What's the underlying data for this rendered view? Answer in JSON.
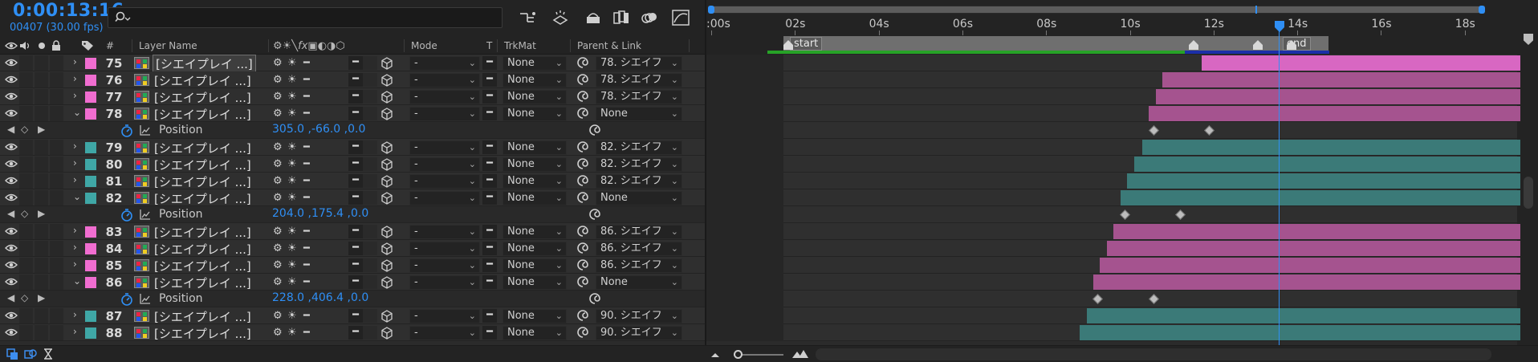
{
  "header": {
    "timecode": "0:00:13:16",
    "frames": "00407 (30.00 fps)",
    "search_placeholder": ""
  },
  "columns": {
    "label": "#",
    "layer_name": "Layer Name",
    "mode": "Mode",
    "t": "T",
    "trkmat": "TrkMat",
    "parent": "Parent & Link"
  },
  "layers": [
    {
      "num": "75",
      "name": "[シエイプレイ ...]",
      "color": "#f06dd0",
      "twirl": "›",
      "mode": "-",
      "trkmat": "None",
      "parent": "78. シエイフ",
      "selected": true
    },
    {
      "num": "76",
      "name": "[シエイプレイ ...]",
      "color": "#f06dd0",
      "twirl": "›",
      "mode": "-",
      "trkmat": "None",
      "parent": "78. シエイフ"
    },
    {
      "num": "77",
      "name": "[シエイプレイ ...]",
      "color": "#f06dd0",
      "twirl": "›",
      "mode": "-",
      "trkmat": "None",
      "parent": "78. シエイフ"
    },
    {
      "num": "78",
      "name": "[シエイプレイ ...]",
      "color": "#f06dd0",
      "twirl": "⌄",
      "mode": "-",
      "trkmat": "None",
      "parent": "None"
    },
    {
      "prop": "Position",
      "value": "305.0 ,-66.0 ,0.0"
    },
    {
      "num": "79",
      "name": "[シエイプレイ ...]",
      "color": "#3fa7a6",
      "twirl": "›",
      "mode": "-",
      "trkmat": "None",
      "parent": "82. シエイフ"
    },
    {
      "num": "80",
      "name": "[シエイプレイ ...]",
      "color": "#3fa7a6",
      "twirl": "›",
      "mode": "-",
      "trkmat": "None",
      "parent": "82. シエイフ"
    },
    {
      "num": "81",
      "name": "[シエイプレイ ...]",
      "color": "#3fa7a6",
      "twirl": "›",
      "mode": "-",
      "trkmat": "None",
      "parent": "82. シエイフ"
    },
    {
      "num": "82",
      "name": "[シエイプレイ ...]",
      "color": "#3fa7a6",
      "twirl": "⌄",
      "mode": "-",
      "trkmat": "None",
      "parent": "None"
    },
    {
      "prop": "Position",
      "value": "204.0 ,175.4 ,0.0"
    },
    {
      "num": "83",
      "name": "[シエイプレイ ...]",
      "color": "#f06dd0",
      "twirl": "›",
      "mode": "-",
      "trkmat": "None",
      "parent": "86. シエイフ"
    },
    {
      "num": "84",
      "name": "[シエイプレイ ...]",
      "color": "#f06dd0",
      "twirl": "›",
      "mode": "-",
      "trkmat": "None",
      "parent": "86. シエイフ"
    },
    {
      "num": "85",
      "name": "[シエイプレイ ...]",
      "color": "#f06dd0",
      "twirl": "›",
      "mode": "-",
      "trkmat": "None",
      "parent": "86. シエイフ"
    },
    {
      "num": "86",
      "name": "[シエイプレイ ...]",
      "color": "#f06dd0",
      "twirl": "⌄",
      "mode": "-",
      "trkmat": "None",
      "parent": "None"
    },
    {
      "prop": "Position",
      "value": "228.0 ,406.4 ,0.0"
    },
    {
      "num": "87",
      "name": "[シエイプレイ ...]",
      "color": "#3fa7a6",
      "twirl": "›",
      "mode": "-",
      "trkmat": "None",
      "parent": "90. シエイフ"
    },
    {
      "num": "88",
      "name": "[シエイプレイ ...]",
      "color": "#3fa7a6",
      "twirl": "›",
      "mode": "-",
      "trkmat": "None",
      "parent": "90. シエイフ"
    }
  ],
  "timeline": {
    "ruler_labels": [
      ":00s",
      "02s",
      "04s",
      "06s",
      "08s",
      "10s",
      "12s",
      "14s",
      "16s",
      "18s"
    ],
    "markers": [
      "start",
      "end"
    ],
    "current_time_seconds": 13.53
  },
  "colors": {
    "accent_blue": "#2f8ff5",
    "label_pink": "#f06dd0",
    "label_teal": "#3fa7a6"
  }
}
